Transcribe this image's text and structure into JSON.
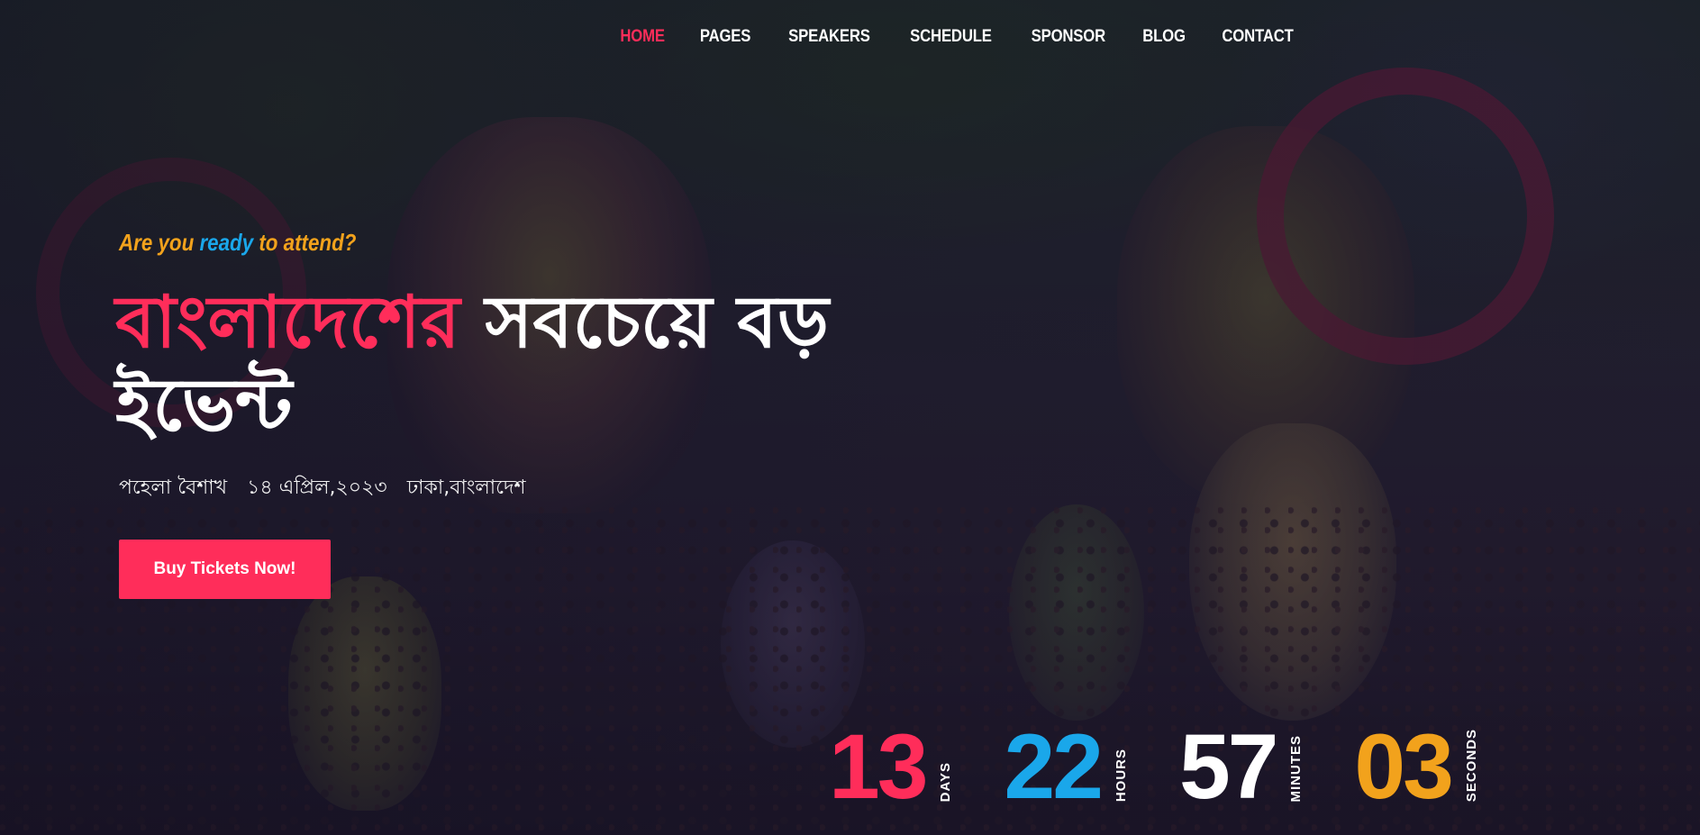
{
  "nav": {
    "items": [
      {
        "label": "HOME",
        "active": true
      },
      {
        "label": "PAGES",
        "active": false
      },
      {
        "label": "SPEAKERS",
        "active": false
      },
      {
        "label": "SCHEDULE",
        "active": false
      },
      {
        "label": "SPONSOR",
        "active": false
      },
      {
        "label": "BLOG",
        "active": false
      },
      {
        "label": "CONTACT",
        "active": false
      }
    ]
  },
  "hero": {
    "tagline_pre": "Are you ",
    "tagline_highlight": "ready",
    "tagline_post": " to attend?",
    "title_accent": "বাংলাদেশের",
    "title_rest": " সবচেয়ে বড় ইভেন্ট",
    "meta": {
      "event": "পহেলা বৈশাখ",
      "date": "১৪ এপ্রিল,২০২৩",
      "location": "ঢাকা,বাংলাদেশ"
    },
    "cta_label": "Buy Tickets Now!"
  },
  "countdown": {
    "days": {
      "value": "13",
      "label": "DAYS"
    },
    "hours": {
      "value": "22",
      "label": "HOURS"
    },
    "minutes": {
      "value": "57",
      "label": "MINUTES"
    },
    "seconds": {
      "value": "03",
      "label": "SECONDS"
    }
  },
  "colors": {
    "accent": "#ff2d5a",
    "tagline": "#f2a21c",
    "highlight": "#1aa7ea",
    "days": "#ff2d5a",
    "hours": "#1aa7ea",
    "minutes": "#ffffff",
    "seconds": "#f2a21c"
  }
}
